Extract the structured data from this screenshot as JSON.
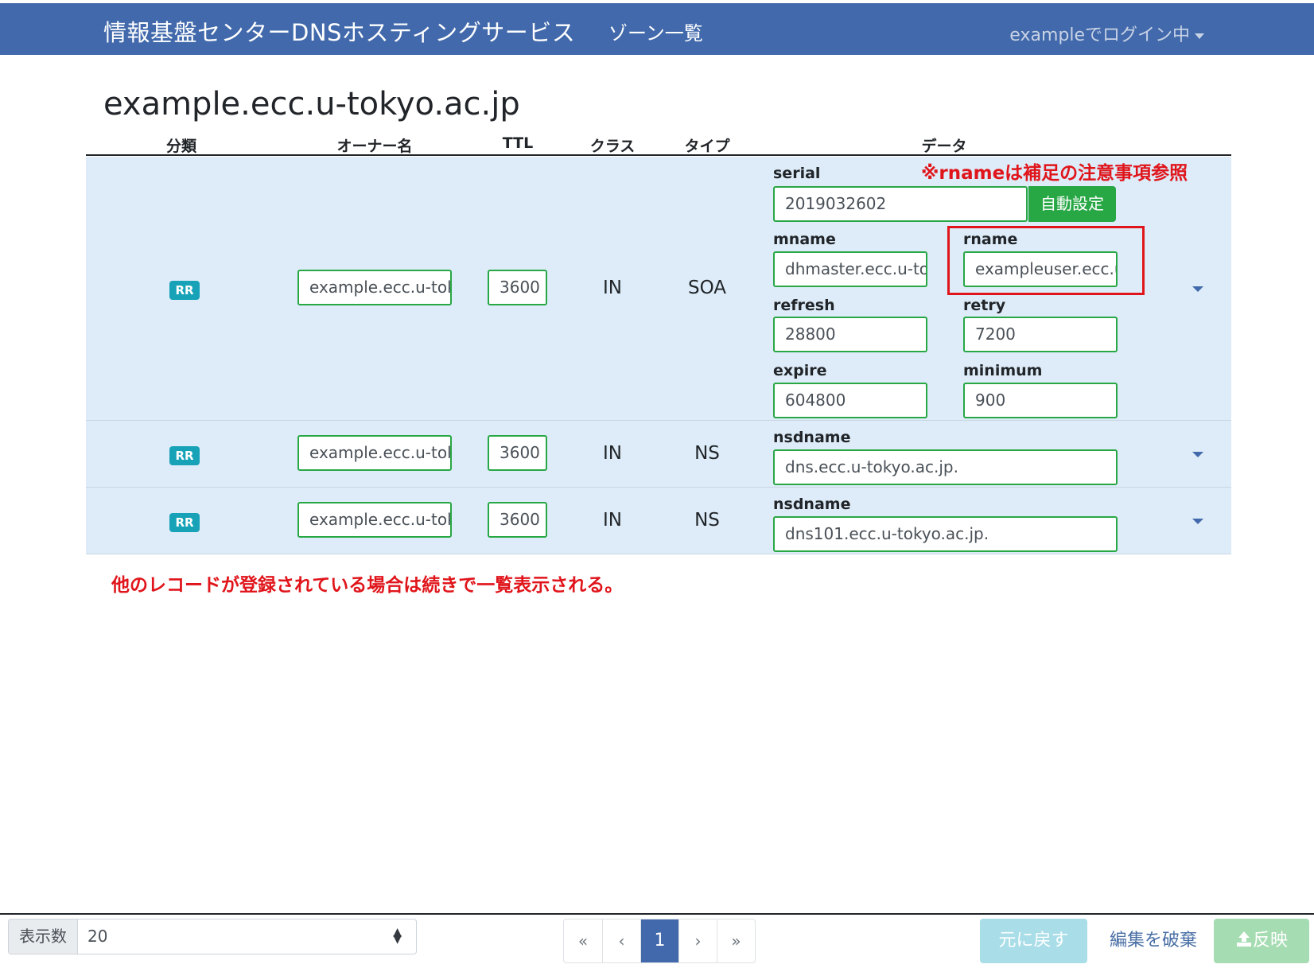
{
  "navbar": {
    "brand": "情報基盤センターDNSホスティングサービス",
    "zone_list_link": "ゾーン一覧",
    "user_menu": "exampleでログイン中"
  },
  "zone_title": "example.ecc.u-tokyo.ac.jp",
  "table": {
    "headers": {
      "category": "分類",
      "owner": "オーナー名",
      "ttl": "TTL",
      "class": "クラス",
      "type": "タイプ",
      "data": "データ"
    },
    "rows": [
      {
        "category": "RR",
        "owner": "example.ecc.u-tok",
        "ttl": "3600",
        "class": "IN",
        "type": "SOA",
        "fields": {
          "serial": {
            "label": "serial",
            "value": "2019032602"
          },
          "auto_button": "自動設定",
          "mname": {
            "label": "mname",
            "value": "dhmaster.ecc.u-to"
          },
          "rname": {
            "label": "rname",
            "value": "exampleuser.ecc.u"
          },
          "refresh": {
            "label": "refresh",
            "value": "28800"
          },
          "retry": {
            "label": "retry",
            "value": "7200"
          },
          "expire": {
            "label": "expire",
            "value": "604800"
          },
          "minimum": {
            "label": "minimum",
            "value": "900"
          }
        }
      },
      {
        "category": "RR",
        "owner": "example.ecc.u-tok",
        "ttl": "3600",
        "class": "IN",
        "type": "NS",
        "fields": {
          "nsdname": {
            "label": "nsdname",
            "value": "dns.ecc.u-tokyo.ac.jp."
          }
        }
      },
      {
        "category": "RR",
        "owner": "example.ecc.u-tok",
        "ttl": "3600",
        "class": "IN",
        "type": "NS",
        "fields": {
          "nsdname": {
            "label": "nsdname",
            "value": "dns101.ecc.u-tokyo.ac.jp."
          }
        }
      }
    ]
  },
  "annotations": {
    "rname_note": "※rnameは補足の注意事項参照",
    "more_records_note": "他のレコードが登録されている場合は続きで一覧表示される。"
  },
  "footer": {
    "per_page_label": "表示数",
    "per_page_value": "20",
    "pagination": [
      "«",
      "‹",
      "1",
      "›",
      "»"
    ],
    "revert_button": "元に戻す",
    "discard_button": "編集を破棄",
    "apply_button": "反映"
  },
  "colors": {
    "navbar": "#4169ab",
    "row_background": "#ddecf8",
    "input_border": "#28a745",
    "badge": "#17a2b8",
    "annotation": "#e0151b"
  }
}
